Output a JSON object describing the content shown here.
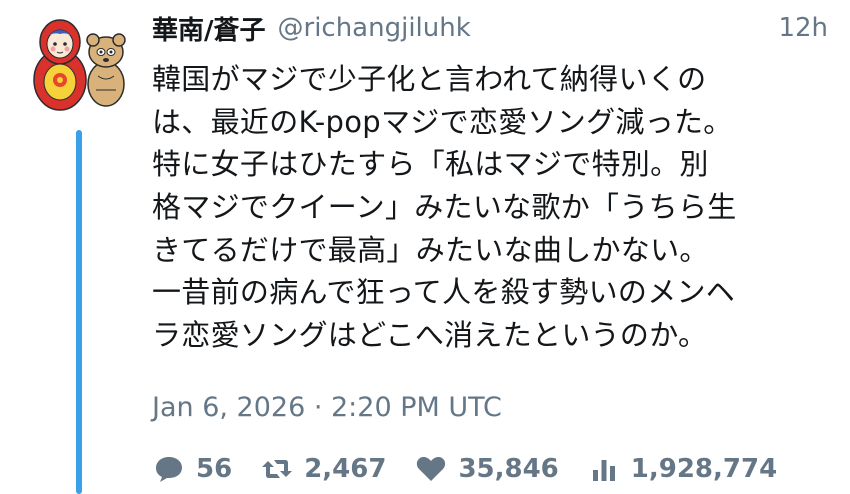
{
  "tweet": {
    "display_name": "華南/蒼子",
    "handle": "@richangjiluhk",
    "time_ago": "12h",
    "avatar_icon": "matryoshka-doll-and-bear-avatar",
    "thread_line_color": "#3aa0e8",
    "body_lines": [
      "韓国がマジで少子化と言われて納得いくの",
      "は、最近のK-popマジで恋愛ソング減った。",
      "特に女子はひたすら「私はマジで特別。別",
      "格マジでクイーン」みたいな歌か「うちら生",
      "きてるだけで最高」みたいな曲しかない。",
      "一昔前の病んで狂って人を殺す勢いのメンヘ",
      "ラ恋愛ソングはどこへ消えたというのか。"
    ],
    "timestamp": "Jan 6, 2026 · 2:20 PM UTC",
    "stats": {
      "replies": "56",
      "retweets": "2,467",
      "likes": "35,846",
      "views": "1,928,774"
    },
    "icons": {
      "reply": "speech-bubble-icon",
      "retweet": "retweet-icon",
      "like": "heart-icon",
      "views": "bar-chart-icon"
    }
  }
}
